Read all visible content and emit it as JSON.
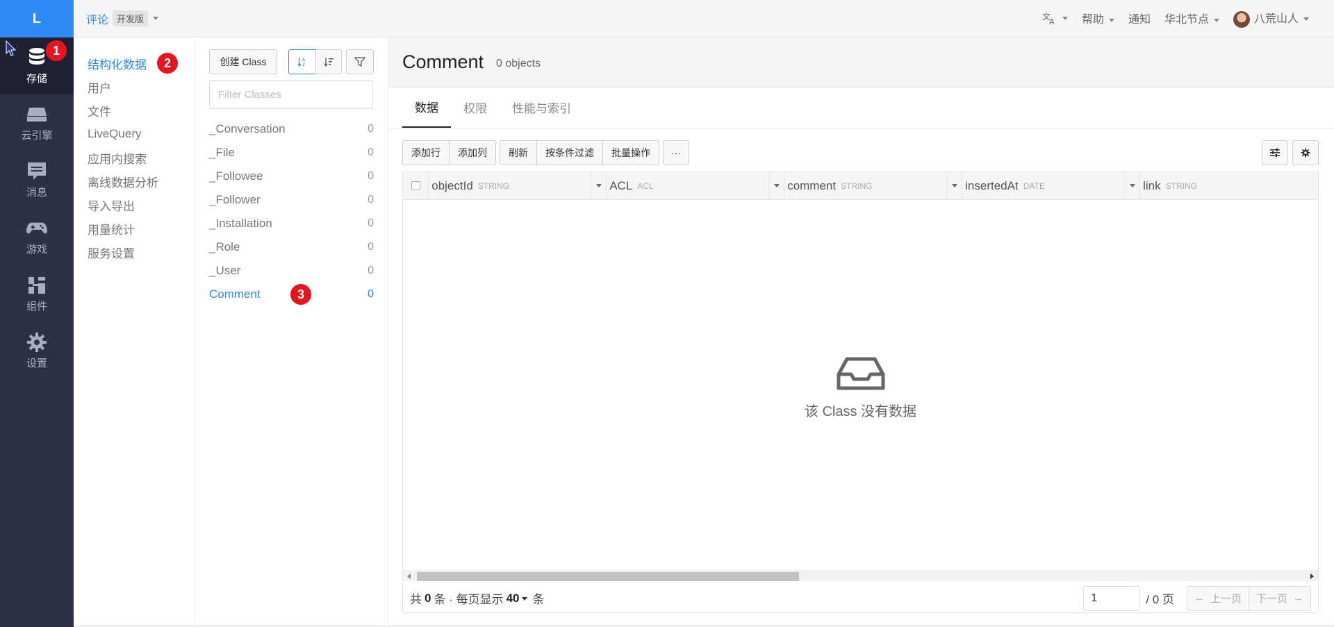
{
  "logo": "L",
  "leftnav": [
    {
      "label": "存储",
      "icon": "database-icon",
      "active": true
    },
    {
      "label": "云引擎",
      "icon": "server-icon"
    },
    {
      "label": "消息",
      "icon": "message-icon"
    },
    {
      "label": "游戏",
      "icon": "gamepad-icon"
    },
    {
      "label": "组件",
      "icon": "components-icon"
    },
    {
      "label": "设置",
      "icon": "gear-icon"
    }
  ],
  "badges": {
    "one": "1",
    "two": "2",
    "three": "3"
  },
  "topbar": {
    "app_name": "评论",
    "env": "开发版",
    "help": "帮助",
    "notify": "通知",
    "region": "华北节点",
    "user": "八荒山人"
  },
  "subnav": [
    "结构化数据",
    "用户",
    "文件",
    "LiveQuery",
    "应用内搜索",
    "离线数据分析",
    "导入导出",
    "用量统计",
    "服务设置"
  ],
  "classcol": {
    "create_label": "创建 Class",
    "filter_placeholder": "Filter Classes",
    "classes": [
      {
        "name": "_Conversation",
        "count": "0"
      },
      {
        "name": "_File",
        "count": "0"
      },
      {
        "name": "_Followee",
        "count": "0"
      },
      {
        "name": "_Follower",
        "count": "0"
      },
      {
        "name": "_Installation",
        "count": "0"
      },
      {
        "name": "_Role",
        "count": "0"
      },
      {
        "name": "_User",
        "count": "0"
      },
      {
        "name": "Comment",
        "count": "0"
      }
    ]
  },
  "main": {
    "title": "Comment",
    "subtitle": "0 objects",
    "tabs": [
      "数据",
      "权限",
      "性能与索引"
    ],
    "toolbar": {
      "add_row": "添加行",
      "add_col": "添加列",
      "refresh": "刷新",
      "filter": "按条件过滤",
      "batch": "批量操作",
      "more": "···"
    },
    "columns": [
      {
        "name": "objectId",
        "type": "STRING"
      },
      {
        "name": "ACL",
        "type": "ACL"
      },
      {
        "name": "comment",
        "type": "STRING"
      },
      {
        "name": "insertedAt",
        "type": "DATE"
      },
      {
        "name": "link",
        "type": "STRING"
      }
    ],
    "empty_text": "该 Class 没有数据",
    "pager": {
      "total_prefix": "共",
      "total": "0",
      "total_mid": "条 · 每页显示",
      "per_page": "40",
      "total_suffix": "条",
      "page_value": "1",
      "page_total": "/ 0 页",
      "prev": "上一页",
      "next": "下一页"
    }
  }
}
